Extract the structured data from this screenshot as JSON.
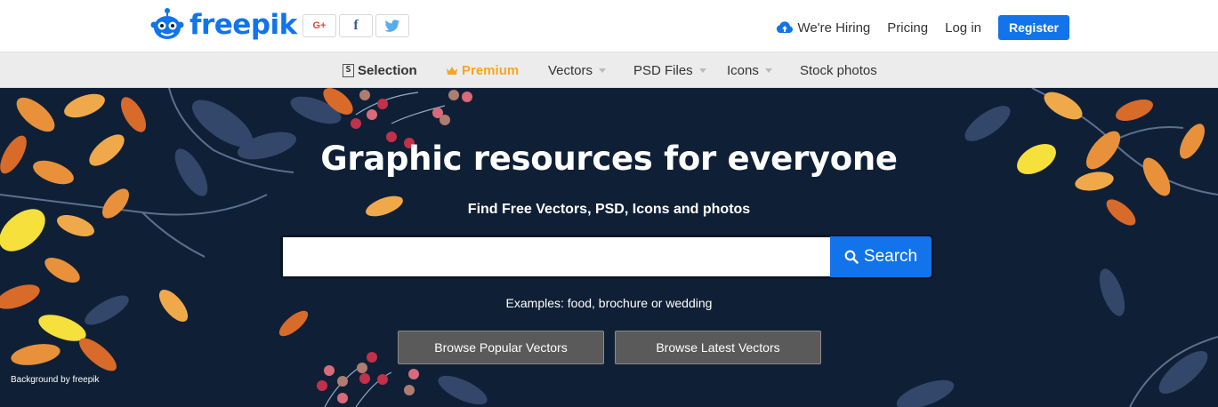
{
  "brand": {
    "name": "freepik",
    "color": "#1273eb"
  },
  "header": {
    "social": [
      {
        "label": "G+",
        "icon": "google-plus-icon"
      },
      {
        "label": "f",
        "icon": "facebook-icon"
      },
      {
        "label": "",
        "icon": "twitter-icon"
      }
    ],
    "hiring_label": "We're Hiring",
    "pricing_label": "Pricing",
    "login_label": "Log in",
    "register_label": "Register"
  },
  "subnav": {
    "selection_badge": "S",
    "items": [
      {
        "label": "Selection"
      },
      {
        "label": "Premium"
      },
      {
        "label": "Vectors"
      },
      {
        "label": "PSD Files"
      },
      {
        "label": "Icons"
      },
      {
        "label": "Stock photos"
      }
    ]
  },
  "hero": {
    "title": "Graphic resources for everyone",
    "subtitle": "Find Free Vectors, PSD, Icons and photos",
    "search_value": "",
    "search_placeholder": "",
    "search_button": "Search",
    "examples": "Examples: food, brochure or wedding",
    "browse_popular": "Browse Popular Vectors",
    "browse_latest": "Browse Latest Vectors",
    "credit": "Background by freepik"
  },
  "colors": {
    "accent": "#1273eb",
    "premium": "#f5a623",
    "hero_bg": "#0f2036",
    "subnav_bg": "#ececec"
  }
}
